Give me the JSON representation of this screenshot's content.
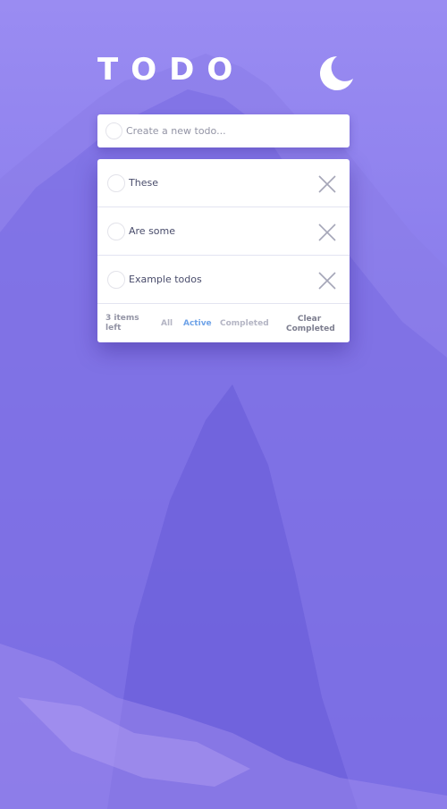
{
  "header": {
    "title": "TODO",
    "theme_icon": "moon-icon"
  },
  "new_todo": {
    "placeholder": "Create a new todo..."
  },
  "todos": [
    {
      "text": "These",
      "completed": false
    },
    {
      "text": "Are some",
      "completed": false
    },
    {
      "text": "Example todos",
      "completed": false
    }
  ],
  "footer": {
    "items_left_line1": "3 items",
    "items_left_line2": "left",
    "filters": [
      "All",
      "Active",
      "Completed"
    ],
    "selected_filter": "Active",
    "clear_line1": "Clear",
    "clear_line2": "Completed"
  },
  "colors": {
    "background": "#7468e8",
    "card": "#ffffff",
    "text": "#494c6b",
    "muted": "#9394a5",
    "active_filter": "#6fa3e8",
    "divider": "#e3e4f1"
  }
}
